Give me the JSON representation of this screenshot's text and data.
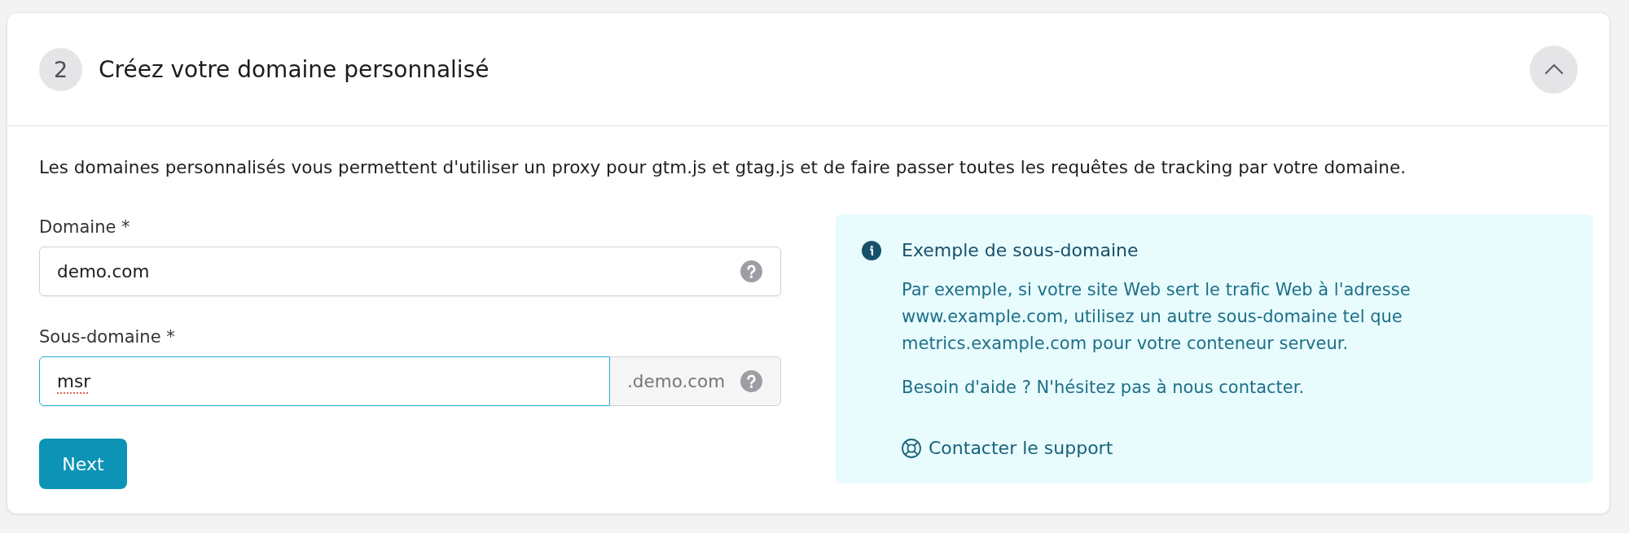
{
  "step": {
    "number": "2",
    "title": "Créez votre domaine personnalisé",
    "expanded": true
  },
  "description": "Les domaines personnalisés vous permettent d'utiliser un proxy pour gtm.js et gtag.js et de faire passer toutes les requêtes de tracking par votre domaine.",
  "fields": [
    {
      "kind": "plain",
      "label": "Domaine *",
      "value": "demo.com",
      "focused": false,
      "spelling_error": false
    },
    {
      "kind": "suffix",
      "label": "Sous-domaine *",
      "value": "msr",
      "suffix": ".demo.com",
      "focused": true,
      "spelling_error": true
    }
  ],
  "next_button": "Next",
  "info_box": {
    "title": "Exemple de sous-domaine",
    "paragraphs": [
      "Par exemple, si votre site Web sert le trafic Web à l'adresse www.example.com, utilisez un autre sous-domaine tel que metrics.example.com pour votre conteneur serveur.",
      "Besoin d'aide ? N'hésitez pas à nous contacter."
    ],
    "link": "Contacter le support"
  }
}
